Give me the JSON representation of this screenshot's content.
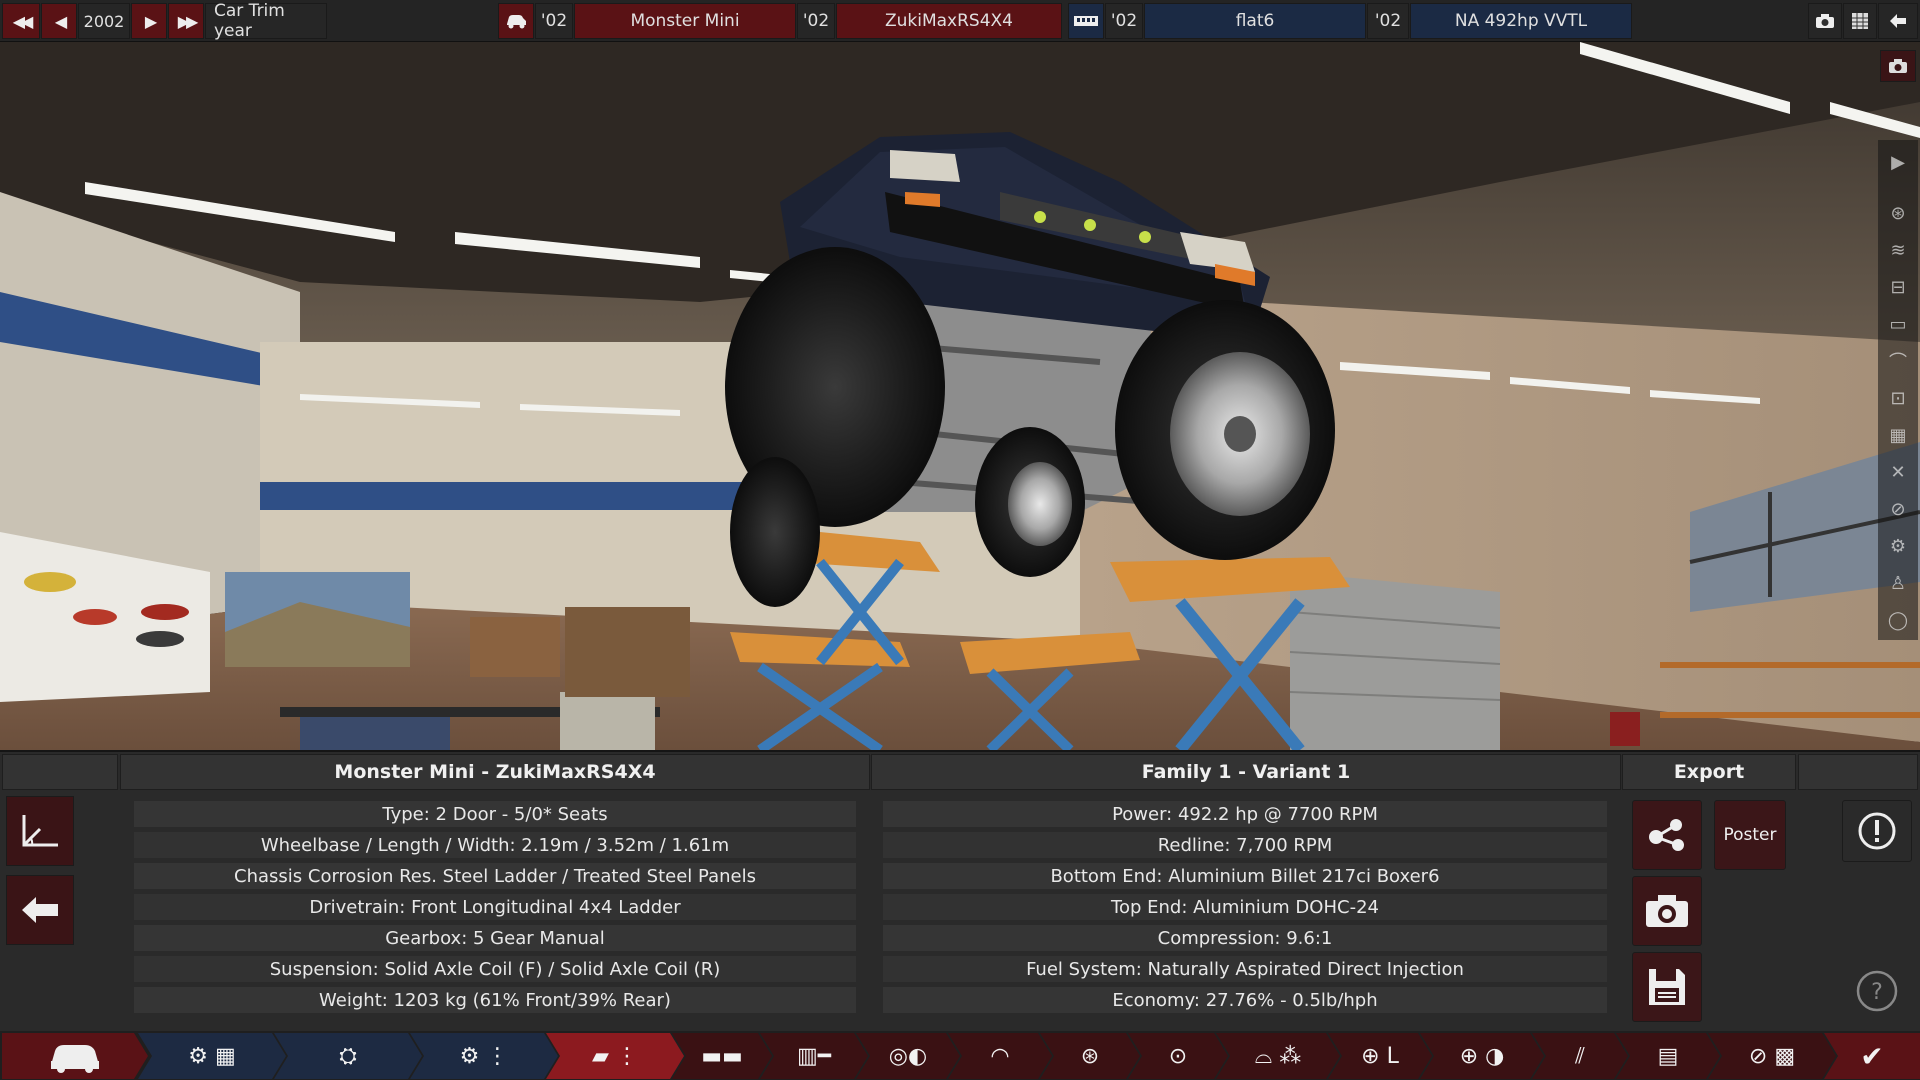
{
  "topbar": {
    "year": "2002",
    "trim_label": "Car Trim year",
    "model_year": "'02",
    "model_name": "Monster Mini",
    "trim_year": "'02",
    "trim_name": "ZukiMaxRS4X4",
    "family_year": "'02",
    "engine_family": "flat6",
    "variant_year": "'02",
    "engine_variant": "NA 492hp VVTL"
  },
  "car_info": {
    "title": "Monster Mini - ZukiMaxRS4X4",
    "rows": [
      "Type: 2 Door - 5/0* Seats",
      "Wheelbase / Length / Width: 2.19m / 3.52m / 1.61m",
      "Chassis Corrosion Res. Steel Ladder / Treated Steel Panels",
      "Drivetrain: Front Longitudinal 4x4 Ladder",
      "Gearbox: 5 Gear Manual",
      "Suspension: Solid Axle Coil (F) / Solid Axle Coil (R)",
      "Weight: 1203 kg (61% Front/39% Rear)"
    ]
  },
  "engine_info": {
    "title": "Family 1 - Variant 1",
    "rows": [
      "Power: 492.2 hp @ 7700 RPM",
      "Redline:  7,700 RPM",
      "Bottom End: Aluminium Billet 217ci Boxer6",
      "Top End: Aluminium DOHC-24",
      "Compression: 9.6:1",
      "Fuel System: Naturally Aspirated Direct Injection",
      "Economy: 27.76% - 0.5lb/hph"
    ]
  },
  "export": {
    "title": "Export",
    "poster_label": "Poster"
  },
  "colors": {
    "accent_red": "#8c1a1f",
    "dark_red": "#5a1216",
    "nav_blue": "#1d2a42",
    "panel": "#2a2a2a"
  },
  "icons": {
    "right_toolbar": [
      "camera-icon",
      "play-icon",
      "wheel-icon",
      "spring-icon",
      "chassis-icon",
      "body-icon",
      "fender-icon",
      "engine-icon",
      "ruler-icon",
      "suspension-icon",
      "brake-icon",
      "gear-icon",
      "person-icon",
      "circle-icon"
    ],
    "bottom_nav": [
      "car-icon",
      "engine-family-icon",
      "engine-icon",
      "engine-tune-icon",
      "car-design-icon",
      "body-profile-icon",
      "chassis-icon",
      "headlight-icon",
      "gauge-icon",
      "wheel-icon",
      "tire-icon",
      "aero-icon",
      "steering-icon",
      "brake-test-icon",
      "spring-icon",
      "spreadsheet-icon",
      "finish-flag-icon",
      "checkmark-icon"
    ]
  }
}
